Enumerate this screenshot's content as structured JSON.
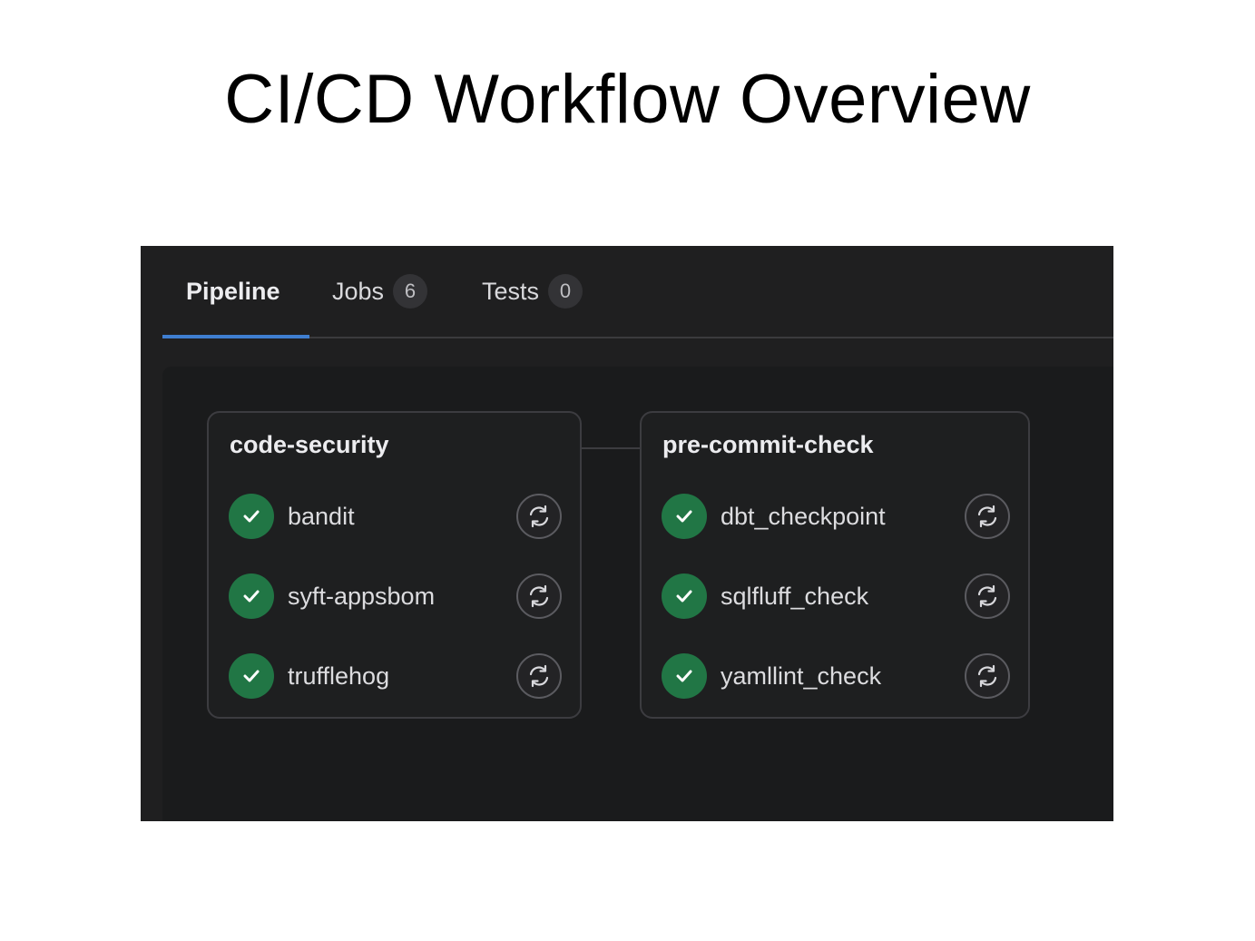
{
  "slide": {
    "title": "CI/CD Workflow Overview"
  },
  "tabs": [
    {
      "label": "Pipeline",
      "active": true
    },
    {
      "label": "Jobs",
      "count": "6"
    },
    {
      "label": "Tests",
      "count": "0"
    }
  ],
  "stages": [
    {
      "name": "code-security",
      "jobs": [
        {
          "name": "bandit",
          "status": "success",
          "icon": "check-icon",
          "action_icon": "retry-icon"
        },
        {
          "name": "syft-appsbom",
          "status": "success",
          "icon": "check-icon",
          "action_icon": "retry-icon"
        },
        {
          "name": "trufflehog",
          "status": "success",
          "icon": "check-icon",
          "action_icon": "retry-icon"
        }
      ]
    },
    {
      "name": "pre-commit-check",
      "jobs": [
        {
          "name": "dbt_checkpoint",
          "status": "success",
          "icon": "check-icon",
          "action_icon": "retry-icon"
        },
        {
          "name": "sqlfluff_check",
          "status": "success",
          "icon": "check-icon",
          "action_icon": "retry-icon"
        },
        {
          "name": "yamllint_check",
          "status": "success",
          "icon": "check-icon",
          "action_icon": "retry-icon"
        }
      ]
    }
  ],
  "colors": {
    "background": "#1f1f20",
    "success": "#217645",
    "active_tab_underline": "#3f7ed0",
    "stage_border": "#3c3c40"
  }
}
